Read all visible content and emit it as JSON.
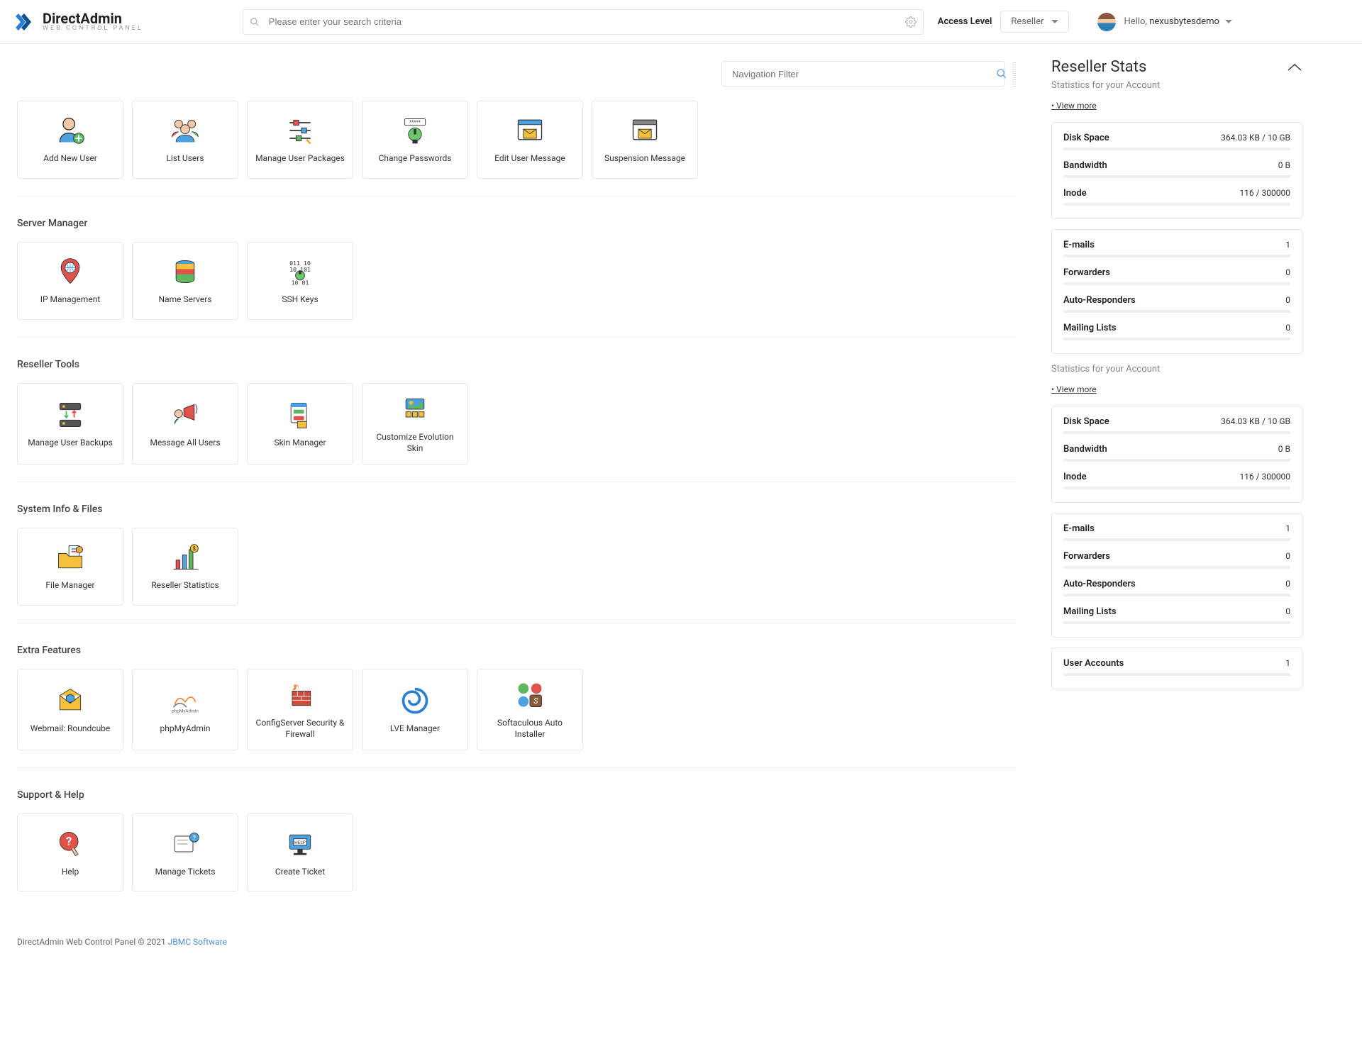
{
  "header": {
    "brand_main": "DirectAdmin",
    "brand_sub": "web control panel",
    "search_placeholder": "Please enter your search criteria",
    "access_label": "Access Level",
    "access_value": "Reseller",
    "user_hello": "Hello, ",
    "user_name": "nexusbytesdemo"
  },
  "nav_filter_placeholder": "Navigation Filter",
  "sections": [
    {
      "title": "",
      "cards": [
        "Add New User",
        "List Users",
        "Manage User Packages",
        "Change Passwords",
        "Edit User Message",
        "Suspension Message"
      ]
    },
    {
      "title": "Server Manager",
      "cards": [
        "IP Management",
        "Name Servers",
        "SSH Keys"
      ]
    },
    {
      "title": "Reseller Tools",
      "cards": [
        "Manage User Backups",
        "Message All Users",
        "Skin Manager",
        "Customize Evolution Skin"
      ]
    },
    {
      "title": "System Info & Files",
      "cards": [
        "File Manager",
        "Reseller Statistics"
      ]
    },
    {
      "title": "Extra Features",
      "cards": [
        "Webmail: Roundcube",
        "phpMyAdmin",
        "ConfigServer Security & Firewall",
        "LVE Manager",
        "Softaculous Auto Installer"
      ]
    },
    {
      "title": "Support & Help",
      "cards": [
        "Help",
        "Manage Tickets",
        "Create Ticket"
      ]
    }
  ],
  "footer": {
    "text": "DirectAdmin Web Control Panel © 2021 ",
    "link": "JBMC Software"
  },
  "sidebar": {
    "title": "Reseller Stats",
    "sub": "Statistics for your Account",
    "view_more": "View more",
    "box1": [
      {
        "label": "Disk Space",
        "value": "364.03 KB / 10 GB"
      },
      {
        "label": "Bandwidth",
        "value": "0 B"
      },
      {
        "label": "Inode",
        "value": "116 / 300000"
      }
    ],
    "box2": [
      {
        "label": "E-mails",
        "value": "1"
      },
      {
        "label": "Forwarders",
        "value": "0"
      },
      {
        "label": "Auto-Responders",
        "value": "0"
      },
      {
        "label": "Mailing Lists",
        "value": "0"
      }
    ],
    "box3": [
      {
        "label": "Disk Space",
        "value": "364.03 KB / 10 GB"
      },
      {
        "label": "Bandwidth",
        "value": "0 B"
      },
      {
        "label": "Inode",
        "value": "116 / 300000"
      }
    ],
    "box4": [
      {
        "label": "E-mails",
        "value": "1"
      },
      {
        "label": "Forwarders",
        "value": "0"
      },
      {
        "label": "Auto-Responders",
        "value": "0"
      },
      {
        "label": "Mailing Lists",
        "value": "0"
      }
    ],
    "box5": [
      {
        "label": "User Accounts",
        "value": "1"
      }
    ]
  },
  "icons": {
    "Add New User": "user-plus",
    "List Users": "users-group",
    "Manage User Packages": "sliders",
    "Change Passwords": "password",
    "Edit User Message": "mail-window",
    "Suspension Message": "mail-window2",
    "IP Management": "ip-pin",
    "Name Servers": "db-stack",
    "SSH Keys": "ssh-key",
    "Manage User Backups": "servers-arrows",
    "Message All Users": "megaphone",
    "Skin Manager": "skin",
    "Customize Evolution Skin": "grid-picture",
    "File Manager": "folder-files",
    "Reseller Statistics": "chart",
    "Webmail: Roundcube": "envelope-cube",
    "phpMyAdmin": "phpmyadmin",
    "ConfigServer Security & Firewall": "firewall",
    "LVE Manager": "swirl",
    "Softaculous Auto Installer": "softaculous",
    "Help": "help",
    "Manage Tickets": "tickets",
    "Create Ticket": "ticket-monitor"
  }
}
